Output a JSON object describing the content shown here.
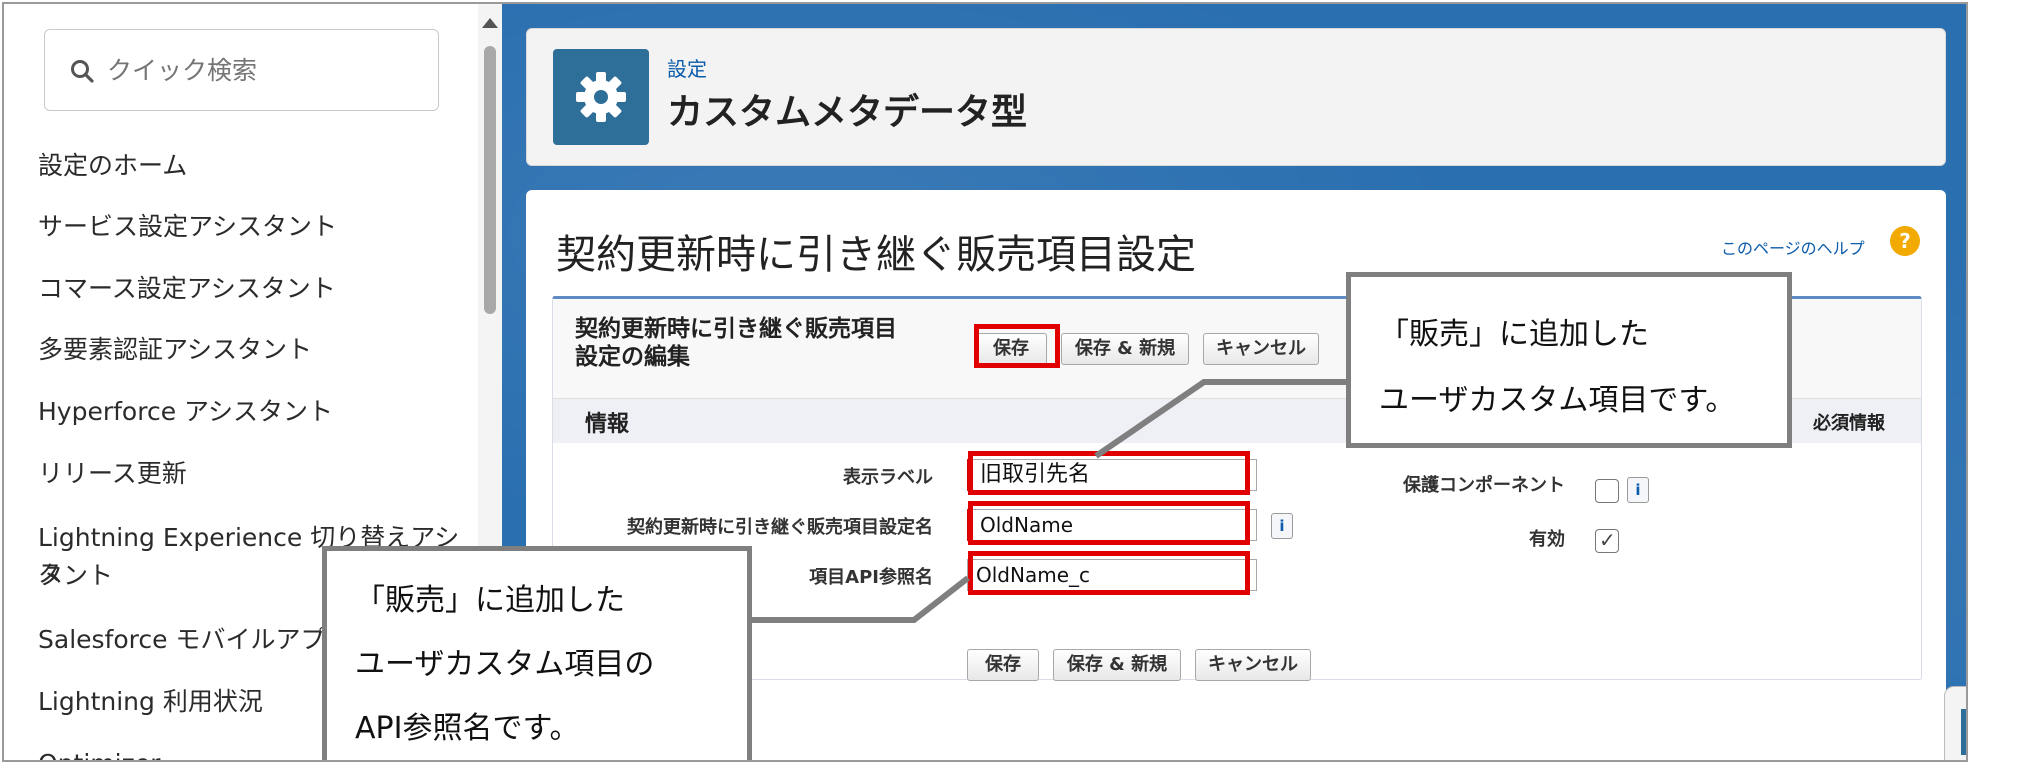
{
  "sidebar": {
    "search_placeholder": "クイック検索",
    "items": [
      "設定のホーム",
      "サービス設定アシスタント",
      "コマース設定アシスタント",
      "多要素認証アシスタント",
      "Hyperforce アシスタント",
      "リリース更新",
      "Lightning Experience 切り替えアシス",
      "タント",
      "Salesforce モバイルアプリ",
      "Lightning 利用状況",
      "Optimizer"
    ]
  },
  "header": {
    "breadcrumb": "設定",
    "title": "カスタムメタデータ型",
    "icon": "gear-icon"
  },
  "page": {
    "form_title": "契約更新時に引き継ぐ販売項目設定",
    "help_link": "このページのヘルプ",
    "help_icon": "?"
  },
  "edit": {
    "heading_line1": "契約更新時に引き継ぐ販売項目",
    "heading_line2": "設定の編集",
    "save": "保存",
    "save_new": "保存 & 新規",
    "cancel": "キャンセル",
    "section": "情報",
    "required": "必須情報",
    "fields": {
      "label_name": "表示ラベル",
      "label_value": "旧取引先名",
      "setting_name": "契約更新時に引き継ぐ販売項目設定名",
      "setting_value": "OldName",
      "api_name": "項目API参照名",
      "api_value": "OldName_c",
      "protected": "保護コンポーネント",
      "active": "有効",
      "info": "i",
      "check": "✓"
    }
  },
  "callouts": {
    "top_line1": "「販売」に追加した",
    "top_line2": "ユーザカスタム項目です。",
    "bottom_line1": "「販売」に追加した",
    "bottom_line2": "ユーザカスタム項目の",
    "bottom_line3": "API参照名です。"
  },
  "colors": {
    "highlight": "#e00000",
    "background": "#2a6fb0",
    "callout_border": "#7f7f7f"
  }
}
